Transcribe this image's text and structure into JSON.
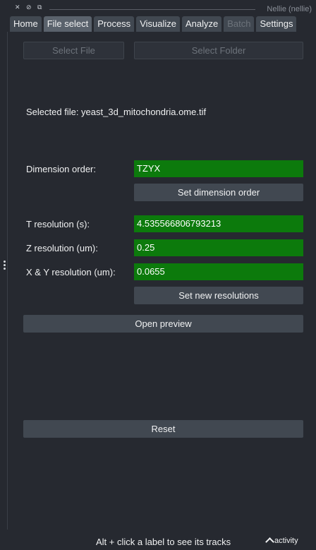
{
  "window": {
    "title": "Nellie (nellie)",
    "close_glyph": "✕",
    "float_glyph": "⊘",
    "dock_glyph": "⧉"
  },
  "tabs": [
    {
      "label": "Home",
      "state": "normal"
    },
    {
      "label": "File select",
      "state": "active"
    },
    {
      "label": "Process",
      "state": "normal"
    },
    {
      "label": "Visualize",
      "state": "normal"
    },
    {
      "label": "Analyze",
      "state": "normal"
    },
    {
      "label": "Batch",
      "state": "disabled"
    },
    {
      "label": "Settings",
      "state": "normal"
    }
  ],
  "file_select": {
    "select_file_label": "Select File",
    "select_folder_label": "Select Folder",
    "selected_file_text": "Selected file: yeast_3d_mitochondria.ome.tif",
    "dimension_order_label": "Dimension order:",
    "dimension_order_value": "TZYX",
    "set_dimension_order_label": "Set dimension order",
    "t_resolution_label": "T resolution (s):",
    "t_resolution_value": "4.535566806793213",
    "z_resolution_label": "Z resolution (um):",
    "z_resolution_value": "0.25",
    "xy_resolution_label": "X & Y resolution (um):",
    "xy_resolution_value": "0.0655",
    "set_resolutions_label": "Set new resolutions",
    "open_preview_label": "Open preview",
    "reset_label": "Reset"
  },
  "statusbar": {
    "hint": "Alt + click a label to see its tracks",
    "activity_label": "activity"
  },
  "colors": {
    "background": "#262930",
    "button": "#414851",
    "field_valid": "#0c7a0c",
    "text": "#f0f1f2"
  }
}
